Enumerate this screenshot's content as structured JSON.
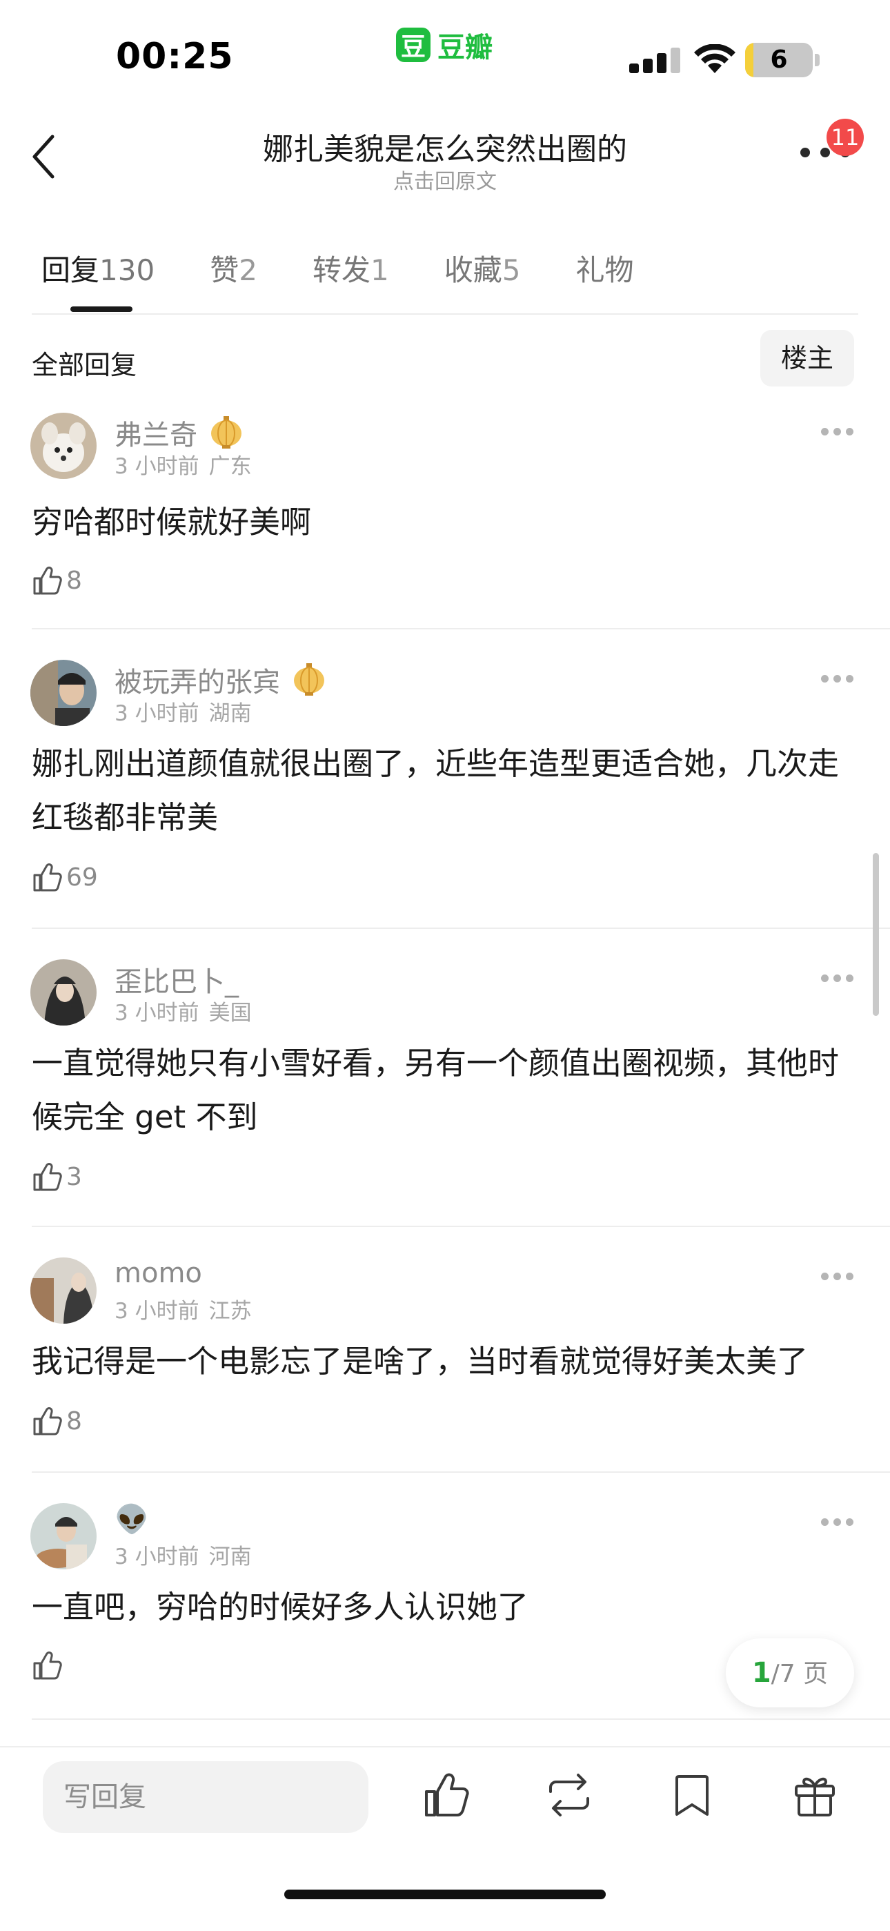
{
  "status_bar": {
    "time": "00:25",
    "source_app_icon": "豆",
    "source_app": "豆瓣",
    "battery_level": "6",
    "battery_fraction": 0.12,
    "icons": [
      "signal-icon",
      "wifi-icon",
      "battery-icon"
    ]
  },
  "nav": {
    "back_icon": "chevron-left-icon",
    "title": "娜扎美貌是怎么突然出圈的",
    "subtitle": "点击回原文",
    "more_icon": "more-icon",
    "notification_count": "11"
  },
  "tabs": [
    {
      "label": "回复",
      "count": "130",
      "active": true
    },
    {
      "label": "赞",
      "count": "2",
      "active": false
    },
    {
      "label": "转发",
      "count": "1",
      "active": false
    },
    {
      "label": "收藏",
      "count": "5",
      "active": false
    },
    {
      "label": "礼物",
      "count": "",
      "active": false
    }
  ],
  "filter": {
    "label": "全部回复",
    "op_only_button": "楼主"
  },
  "comments": [
    {
      "username": "弗兰奇",
      "has_lantern_badge": true,
      "time": "3 小时前",
      "location": "广东",
      "text": "穷哈都时候就好美啊",
      "likes": "8"
    },
    {
      "username": "被玩弄的张宾",
      "has_lantern_badge": true,
      "time": "3 小时前",
      "location": "湖南",
      "text": "娜扎刚出道颜值就很出圈了，近些年造型更适合她，几次走红毯都非常美",
      "likes": "69"
    },
    {
      "username": "歪比巴卜_",
      "has_lantern_badge": false,
      "time": "3 小时前",
      "location": "美国",
      "text": "一直觉得她只有小雪好看，另有一个颜值出圈视频，其他时候完全 get 不到",
      "likes": "3"
    },
    {
      "username": "momo",
      "has_lantern_badge": false,
      "time": "3 小时前",
      "location": "江苏",
      "text": "我记得是一个电影忘了是啥了，当时看就觉得好美太美了",
      "likes": "8"
    },
    {
      "username": "👽",
      "has_lantern_badge": false,
      "time": "3 小时前",
      "location": "河南",
      "text": "一直吧，穷哈的时候好多人认识她了",
      "likes": ""
    }
  ],
  "pager": {
    "current": "1",
    "total_text": "/7 页"
  },
  "bottom_bar": {
    "reply_placeholder": "写回复",
    "icons": [
      "like-icon",
      "repost-icon",
      "bookmark-icon",
      "gift-icon"
    ]
  },
  "colors": {
    "accent_green": "#1fbd3f",
    "badge_red": "#f24a4a",
    "text_primary": "#1a1a1a",
    "text_secondary": "#8a8a8a"
  }
}
